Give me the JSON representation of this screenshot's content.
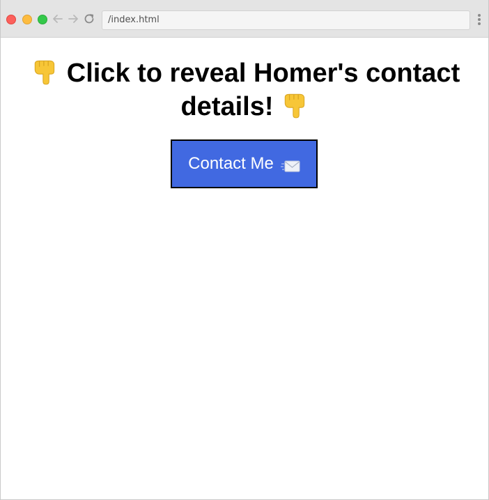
{
  "browser": {
    "url": "/index.html",
    "icons": {
      "back": "arrow-left-icon",
      "forward": "arrow-right-icon",
      "reload": "reload-icon",
      "menu": "vertical-dots-menu-icon"
    }
  },
  "page": {
    "headline": "Click to reveal Homer's contact details!",
    "headline_emoji": "backhand-index-pointing-down",
    "contact_button": {
      "label": "Contact Me",
      "icon": "envelope-icon"
    }
  },
  "colors": {
    "button_bg": "#4169e1",
    "button_border": "#000000",
    "button_text": "#ffffff",
    "chrome_bg": "#e4e4e4",
    "emoji_yellow": "#f7c637"
  }
}
